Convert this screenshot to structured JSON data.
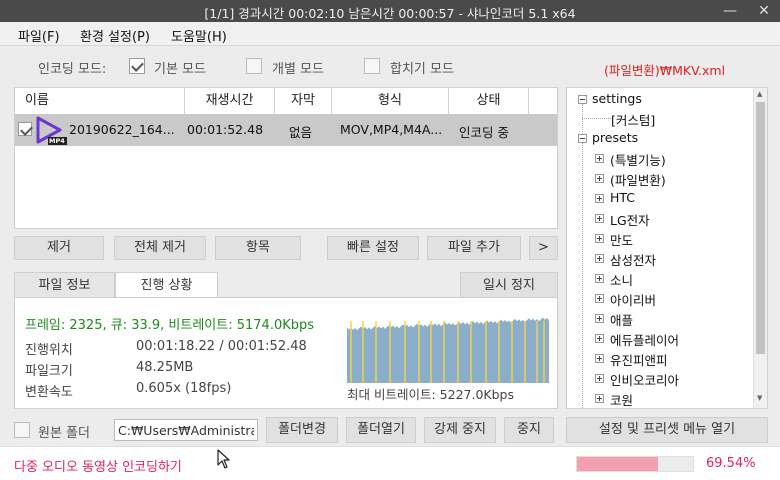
{
  "window": {
    "title": "[1/1] 경과시간  00:02:10   남은시간  00:00:57  -  샤나인코더  5.1  x64",
    "minimize_glyph": "—",
    "close_glyph": "✕"
  },
  "menu": {
    "items": [
      "파일(F)",
      "환경 설정(P)",
      "도움말(H)"
    ]
  },
  "encoding_mode": {
    "label": "인코딩 모드:",
    "options": [
      {
        "label": "기본 모드",
        "checked": true
      },
      {
        "label": "개별 모드",
        "checked": false
      },
      {
        "label": "합치기 모드",
        "checked": false
      }
    ],
    "preset_path": "(파일변환)₩MKV.xml"
  },
  "file_table": {
    "headers": [
      "이름",
      "재생시간",
      "자막",
      "형식",
      "상태"
    ],
    "rows": [
      {
        "name": "20190622_164...",
        "duration": "00:01:52.48",
        "subtitle": "없음",
        "format": "MOV,MP4,M4A...",
        "status": "인코딩 중",
        "badge": "MP4",
        "checked": true
      }
    ]
  },
  "actions": {
    "remove": "제거",
    "remove_all": "전체 제거",
    "item": "항목",
    "quick_settings": "빠른 설정",
    "add_file": "파일 추가",
    "more": ">"
  },
  "tabs": {
    "file_info": "파일 정보",
    "progress": "진행 상황",
    "pause": "일시 정지"
  },
  "progress": {
    "stats": "프레임: 2325, 큐: 33.9, 비트레이트: 5174.0Kbps",
    "position_label": "진행위치",
    "position_value": "00:01:18.22 / 00:01:52.48",
    "size_label": "파일크기",
    "size_value": "48.25MB",
    "speed_label": "변환속도",
    "speed_value": "0.605x (18fps)",
    "max_bitrate": "최대 비트레이트: 5227.0Kbps",
    "graph_fill_fraction": 0.6954
  },
  "presets_tree": {
    "root1": "settings",
    "root1_child": "[커스텀]",
    "root2": "presets",
    "children": [
      "(특별기능)",
      "(파일변환)",
      "HTC",
      "LG전자",
      "만도",
      "삼성전자",
      "소니",
      "아이리버",
      "애플",
      "에듀플레이어",
      "유진피앤피",
      "인비오코리아",
      "코원"
    ]
  },
  "folder_bar": {
    "source_folder_label": "원본 폴더",
    "path_value": "C:₩Users₩Administrator",
    "change_folder": "폴더변경",
    "open_folder": "폴더열기",
    "force_stop": "강제 중지",
    "stop": "중지",
    "settings_menu": "설정 및 프리셋 메뉴 열기"
  },
  "status_bar": {
    "link_text": "다중 오디오 동영상 인코딩하기",
    "percent_text": "69.54%",
    "progress": 0.6954,
    "link_color": "#e0206a",
    "progress_color": "#f4a0b0"
  }
}
